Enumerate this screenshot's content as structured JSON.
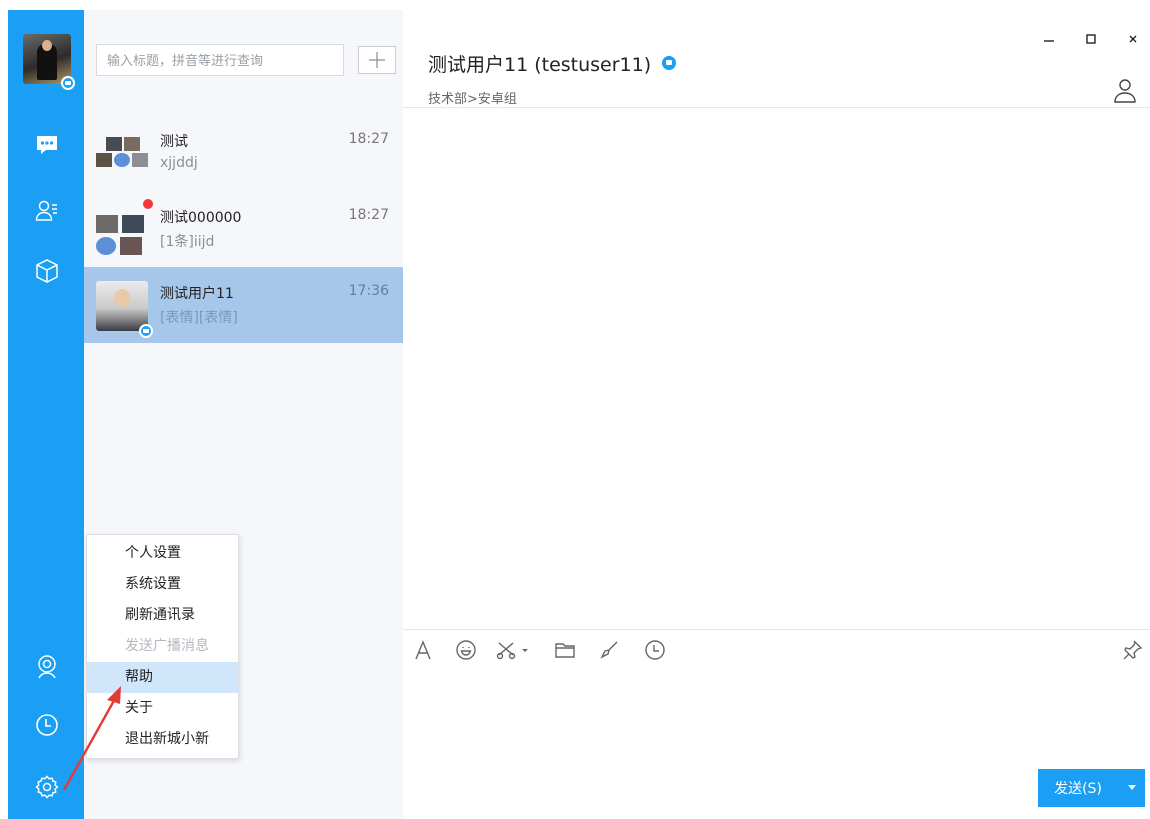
{
  "sidebar": {
    "avatar_icon": "user-avatar-photo",
    "nav_icons": [
      "chat-bubble-icon",
      "contacts-icon",
      "cube-apps-icon"
    ],
    "bottom_icons": [
      "webcam-icon",
      "clock-icon",
      "settings-gear-icon"
    ]
  },
  "list": {
    "search_placeholder": "输入标题，拼音等进行查询",
    "add_icon": "plus-icon",
    "conversations": [
      {
        "name": "测试",
        "time": "18:27",
        "preview": "xjjddj"
      },
      {
        "name": "测试000000",
        "time": "18:27",
        "preview": "[1条]iijd"
      },
      {
        "name": "测试用户11",
        "time": "17:36",
        "preview": "[表情][表情]"
      }
    ]
  },
  "menu": {
    "items": [
      {
        "label": "个人设置",
        "state": "normal"
      },
      {
        "label": "系统设置",
        "state": "normal"
      },
      {
        "label": "刷新通讯录",
        "state": "normal"
      },
      {
        "label": "发送广播消息",
        "state": "disabled"
      },
      {
        "label": "帮助",
        "state": "hover"
      },
      {
        "label": "关于",
        "state": "normal"
      },
      {
        "label": "退出新城小新",
        "state": "normal"
      }
    ]
  },
  "chat": {
    "title": "测试用户11 (testuser11)",
    "subtitle": "技术部>安卓组",
    "toolbar_icons": [
      "font-icon",
      "emoji-icon",
      "screenshot-scissors-icon",
      "folder-icon",
      "brush-icon",
      "history-clock-icon",
      "pin-icon"
    ],
    "send_label": "发送(S)"
  },
  "window": {
    "controls": [
      "minimize-icon",
      "maximize-icon",
      "close-icon"
    ]
  },
  "colors": {
    "brand": "#1a9ff5",
    "active_row": "#a7c7ea",
    "menu_hover": "#cfe6fb",
    "annotation_arrow": "#e53935"
  }
}
